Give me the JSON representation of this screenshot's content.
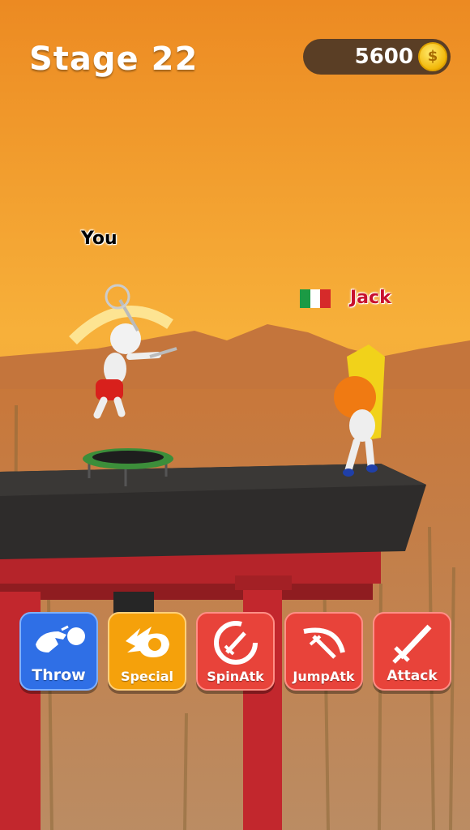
{
  "hud": {
    "stage_label": "Stage 22",
    "coins": "5600",
    "coin_symbol": "$"
  },
  "players": {
    "player_name": "You",
    "opponent_name": "Jack",
    "opponent_flag": "italy-flag-icon"
  },
  "actions": [
    {
      "label": "Throw",
      "icon": "throw-icon",
      "color": "#2f6fe6"
    },
    {
      "label": "Special",
      "icon": "fireball-icon",
      "color": "#f5a10b"
    },
    {
      "label": "SpinAtk",
      "icon": "spin-sword-icon",
      "color": "#e8433a"
    },
    {
      "label": "JumpAtk",
      "icon": "jump-sword-icon",
      "color": "#e8433a"
    },
    {
      "label": "Attack",
      "icon": "sword-icon",
      "color": "#e8433a"
    }
  ]
}
